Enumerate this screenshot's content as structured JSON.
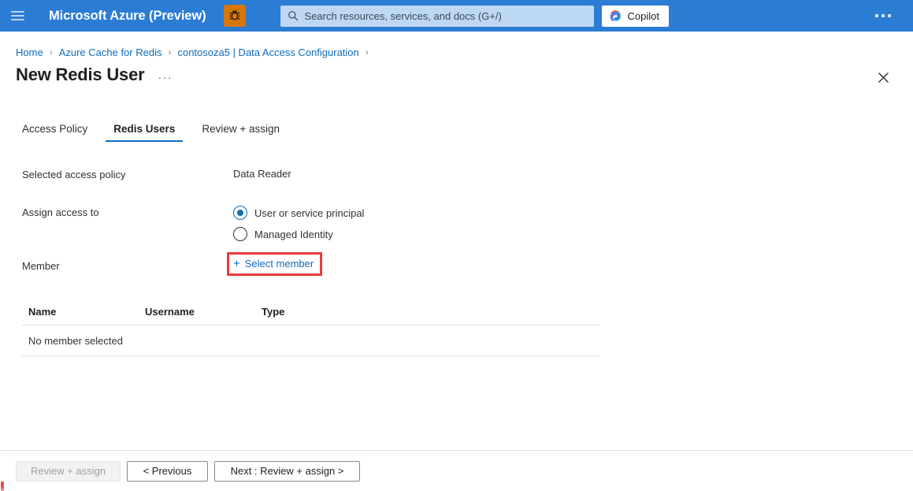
{
  "topbar": {
    "menu_icon": "hamburger-menu-icon",
    "brand": "Microsoft Azure (Preview)",
    "bug_icon": "bug-icon",
    "search": {
      "icon": "search-icon",
      "placeholder": "Search resources, services, and docs (G+/)",
      "value": ""
    },
    "copilot": {
      "icon": "copilot-logo-icon",
      "label": "Copilot"
    },
    "overflow_label": "more-options-icon",
    "background_color": "#2b7cd3"
  },
  "breadcrumb": {
    "items": [
      {
        "label": "Home"
      },
      {
        "label": "Azure Cache for Redis"
      },
      {
        "label": "contosoza5 | Data Access Configuration"
      }
    ],
    "separator": "›",
    "link_color": "#0f6cbd"
  },
  "header": {
    "title": "New Redis User",
    "ellipsis": "···",
    "close_icon": "close-icon"
  },
  "tabs": [
    {
      "label": "Access Policy",
      "active": false
    },
    {
      "label": "Redis Users",
      "active": true
    },
    {
      "label": "Review + assign",
      "active": false
    }
  ],
  "form": {
    "selected_access_policy": {
      "label": "Selected access policy",
      "value": "Data Reader"
    },
    "assign_access_to": {
      "label": "Assign access to",
      "options": [
        {
          "label": "User or service principal",
          "selected": true
        },
        {
          "label": "Managed Identity",
          "selected": false
        }
      ]
    },
    "member": {
      "label": "Member",
      "select_button": "Select member",
      "plus_icon": "plus-icon",
      "highlight_color": "#ec3b3b"
    }
  },
  "table": {
    "columns": [
      "Name",
      "Username",
      "Type"
    ],
    "empty_message": "No member selected",
    "rows": []
  },
  "footer": {
    "buttons": [
      {
        "label": "Review + assign",
        "disabled": true
      },
      {
        "label": "< Previous",
        "disabled": false
      },
      {
        "label": "Next : Review + assign >",
        "disabled": false
      }
    ]
  }
}
